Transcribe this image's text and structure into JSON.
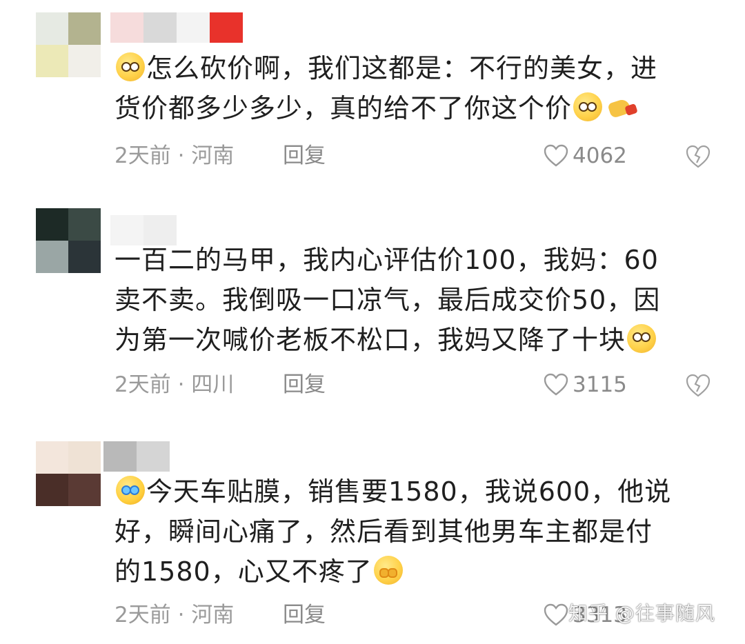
{
  "comments": [
    {
      "lines": [
        "怎么砍价啊，我们这都是：不行的美女，进",
        "货价都多少多少，真的给不了你这个价"
      ],
      "leading_emoji": "smile-emoji",
      "trailing_emoji": [
        "smile-emoji",
        "pointing-hand-emoji"
      ],
      "time": "2天前 · 河南",
      "reply": "回复",
      "likes": "4062"
    },
    {
      "lines": [
        "一百二的马甲，我内心评估价100，我妈：60",
        "卖不卖。我倒吸一口凉气，最后成交价50，因",
        "为第一次喊价老板不松口，我妈又降了十块"
      ],
      "trailing_emoji": [
        "pleading-emoji"
      ],
      "time": "2天前 · 四川",
      "reply": "回复",
      "likes": "3115"
    },
    {
      "lines": [
        "今天车贴膜，销售要1580，我说600，他说",
        "好，瞬间心痛了，然后看到其他男车主都是付",
        "的1580，心又不疼了"
      ],
      "leading_emoji": "crying-emoji",
      "trailing_emoji": [
        "cover-face-emoji"
      ],
      "time": "2天前 · 河南",
      "reply": "回复",
      "likes": "3313"
    }
  ],
  "watermark": "知乎 @往事随风",
  "colors": {
    "text": "#1f1f1f",
    "meta": "#9a9a9a",
    "emoji": "#ffd24a"
  }
}
